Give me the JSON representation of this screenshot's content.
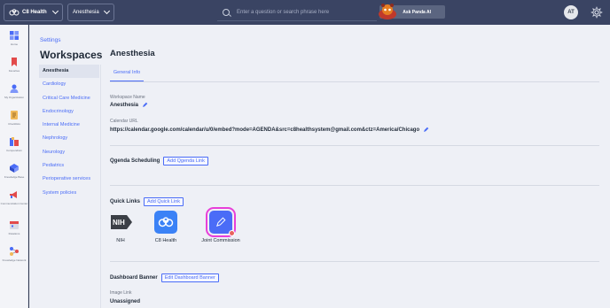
{
  "topbar": {
    "org_name": "C8 Health",
    "workspace_select": "Anesthesia",
    "search_placeholder": "Enter a question or search phrase here",
    "ask_panda_label": "Ask Panda AI",
    "avatar_initials": "AT"
  },
  "rail": {
    "items": [
      {
        "label": "Home",
        "icon": "home-icon"
      },
      {
        "label": "Favorites",
        "icon": "bookmark-icon"
      },
      {
        "label": "My Organization",
        "icon": "organization-icon"
      },
      {
        "label": "Checklists",
        "icon": "checklist-icon"
      },
      {
        "label": "Compendium",
        "icon": "compendium-icon"
      },
      {
        "label": "Knowledge Base",
        "icon": "knowledge-base-icon"
      },
      {
        "label": "Communication Center",
        "icon": "megaphone-icon"
      },
      {
        "label": "Rotations",
        "icon": "calendar-icon"
      },
      {
        "label": "Knowledge Network",
        "icon": "network-icon"
      }
    ]
  },
  "settings": {
    "breadcrumb": "Settings",
    "title": "Workspaces",
    "workspaces": [
      "Anesthesia",
      "Cardiology",
      "Critical Care Medicine",
      "Endocrinology",
      "Internal Medicine",
      "Nephrology",
      "Neurology",
      "Pediatrics",
      "Perioperative services",
      "System policies"
    ],
    "active_workspace_index": 0
  },
  "main": {
    "title": "Anesthesia",
    "tab_label": "General Info",
    "workspace_name_label": "Workspace Name",
    "workspace_name_value": "Anesthesia",
    "calendar_url_label": "Calendar URL",
    "calendar_url_value": "https://calendar.google.com/calendar/u/0/embed?mode=AGENDA&src=c8healthsystem@gmail.com&ctz=America/Chicago",
    "qgenda_title": "Qgenda Scheduling",
    "qgenda_button": "Add Qgenda Link",
    "quick_links_title": "Quick Links",
    "quick_links_button": "Add Quick Link",
    "quick_links": [
      {
        "label": "NIH",
        "icon": "nih-logo"
      },
      {
        "label": "C8 Health",
        "icon": "c8-logo"
      },
      {
        "label": "Joint Commission",
        "icon": "pen-icon"
      }
    ],
    "dashboard_banner_title": "Dashboard Banner",
    "dashboard_banner_button": "Edit Dashboard Banner",
    "image_link_label": "Image Link",
    "image_link_value": "Unassigned"
  },
  "colors": {
    "topbar": "#3a4463",
    "accent": "#4a6cf7",
    "highlight": "#e83fd9",
    "content_bg": "#eef0f6"
  }
}
